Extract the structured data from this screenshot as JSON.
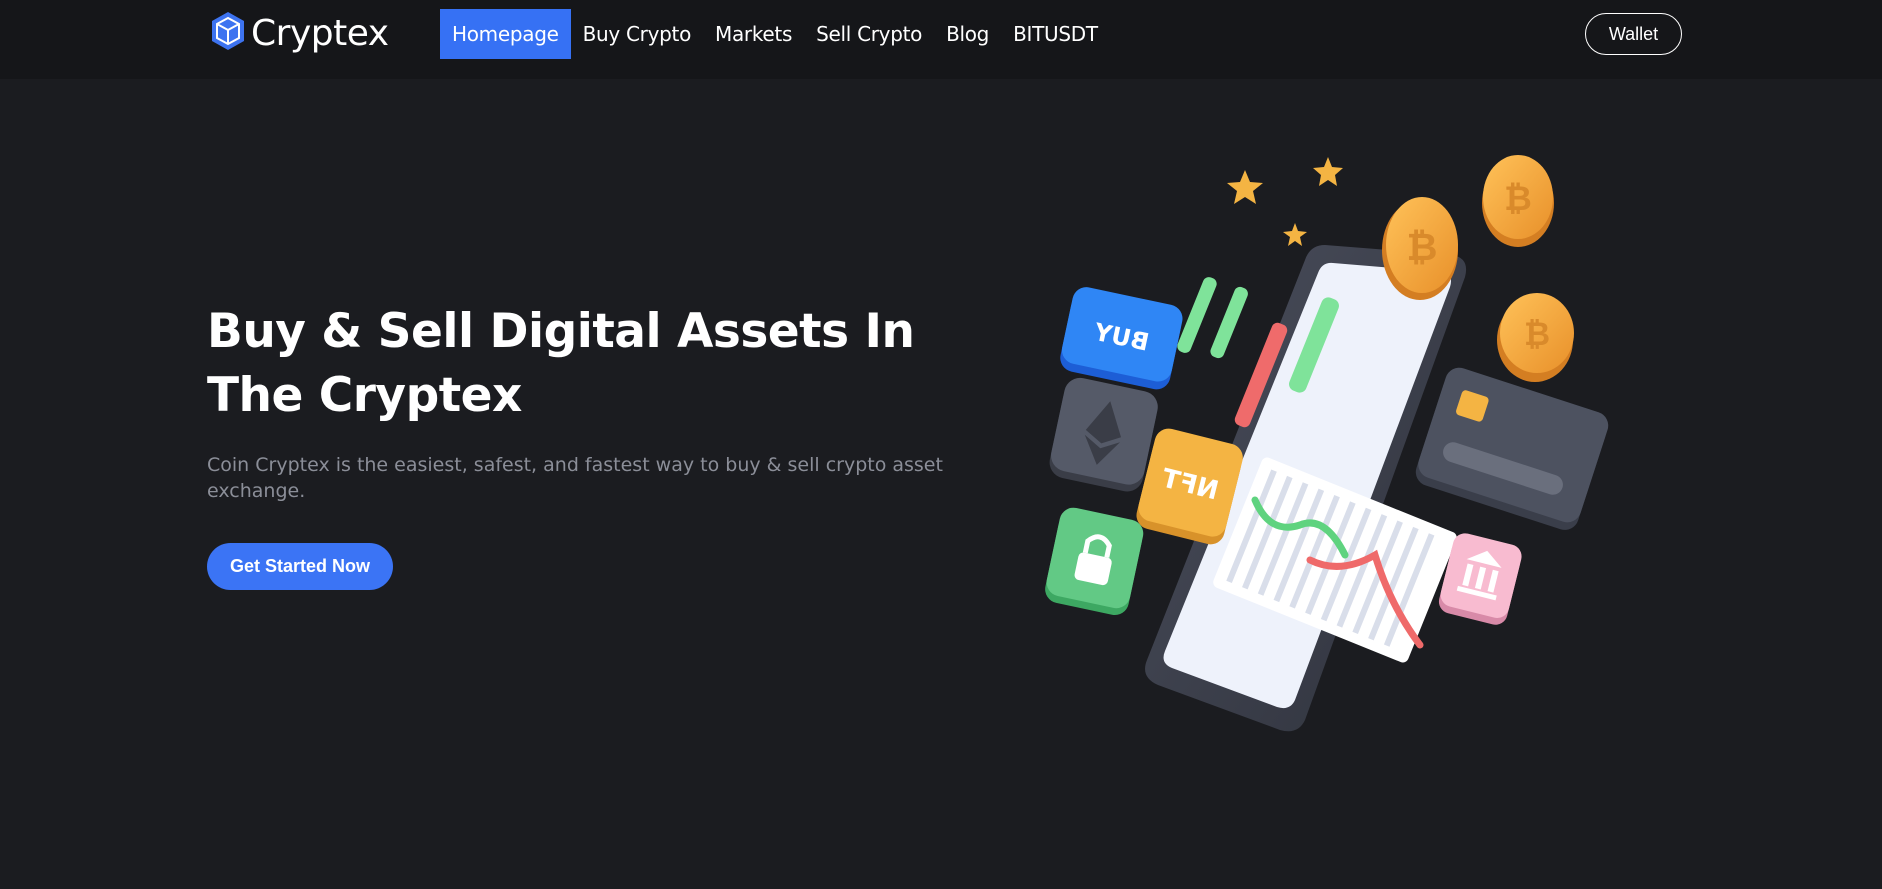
{
  "header": {
    "brand": "Cryptex",
    "nav": [
      {
        "label": "Homepage",
        "active": true
      },
      {
        "label": "Buy Crypto",
        "active": false
      },
      {
        "label": "Markets",
        "active": false
      },
      {
        "label": "Sell Crypto",
        "active": false
      },
      {
        "label": "Blog",
        "active": false
      },
      {
        "label": "BITUSDT",
        "active": false
      }
    ],
    "wallet_label": "Wallet"
  },
  "hero": {
    "title": "Buy & Sell Digital Assets In The Cryptex",
    "subtitle": "Coin Cryptex is the easiest, safest, and fastest way to buy & sell crypto asset exchange.",
    "cta_label": "Get Started Now"
  },
  "illustration": {
    "buy_tile_text": "BUY",
    "nft_tile_text": "NFT"
  },
  "colors": {
    "accent": "#3671f4",
    "background": "#1b1c20",
    "header": "#151619",
    "muted_text": "#8b8e98"
  }
}
